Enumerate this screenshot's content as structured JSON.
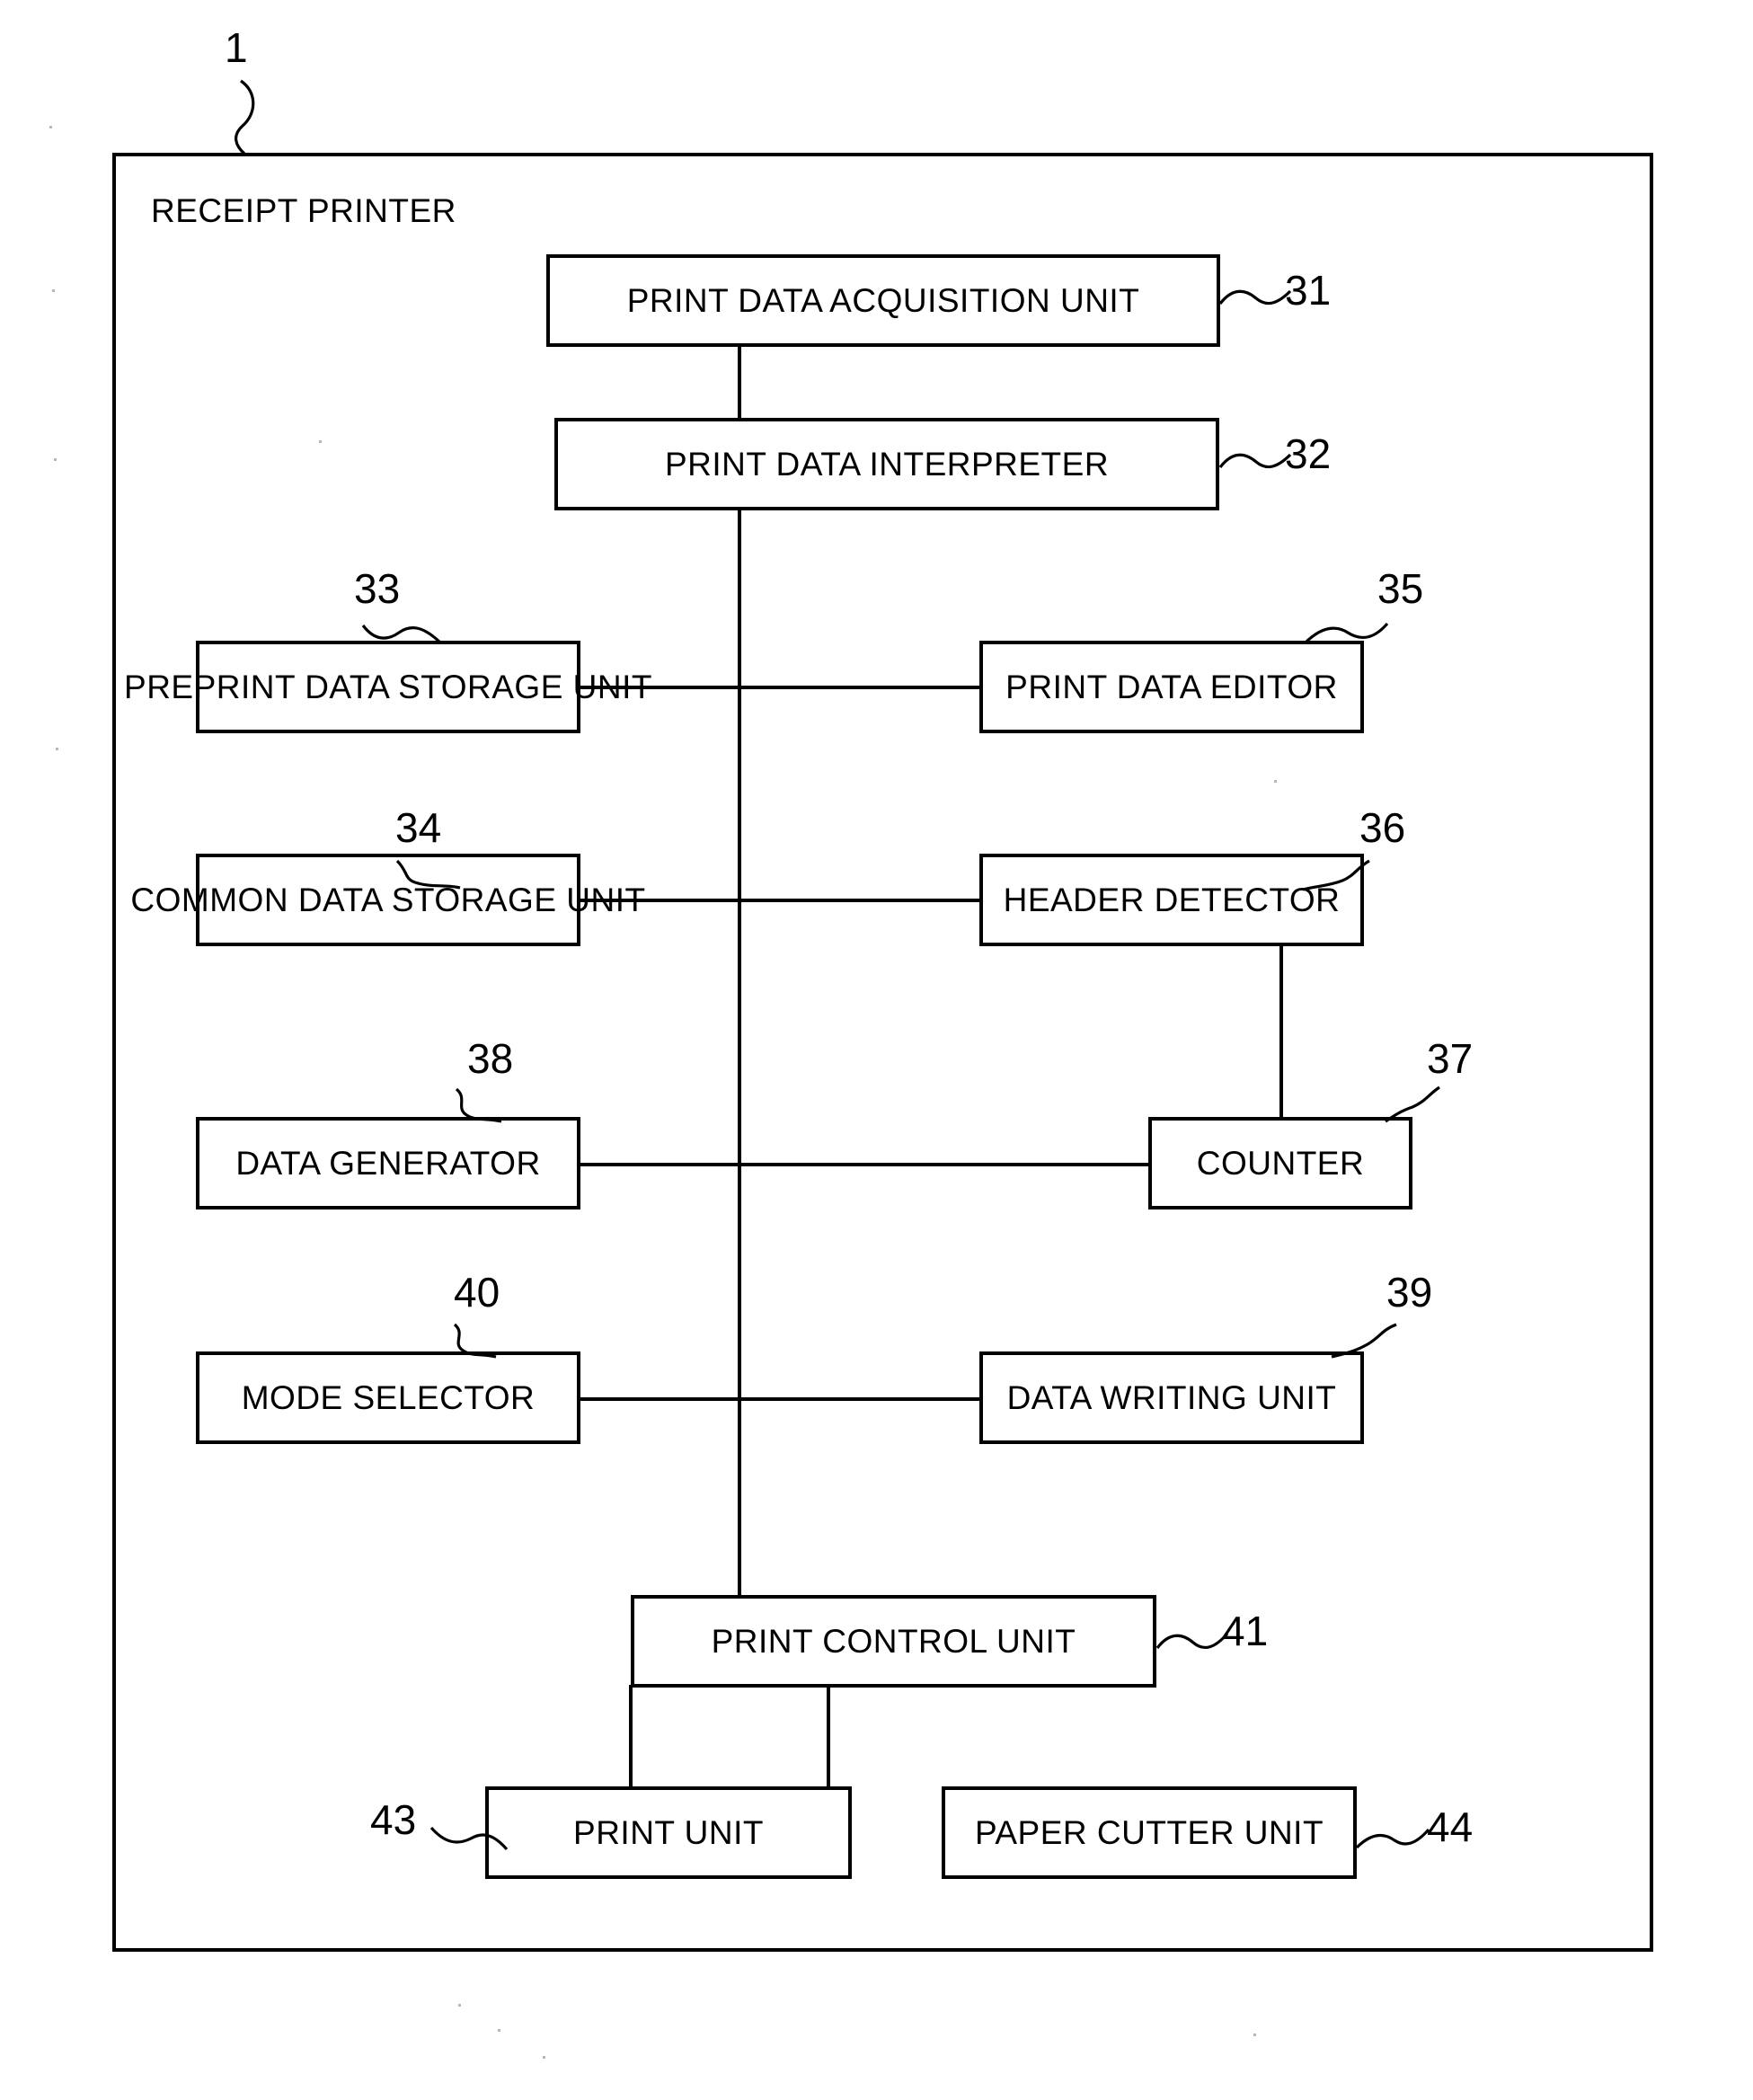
{
  "figure": {
    "enclosure_title": "RECEIPT PRINTER",
    "enclosure_ref": "1",
    "background_color": "#ffffff",
    "line_color": "#000000"
  },
  "blocks": [
    {
      "id": "print-data-acquisition-unit",
      "label": "PRINT DATA ACQUISITION UNIT",
      "ref": "31"
    },
    {
      "id": "print-data-interpreter",
      "label": "PRINT DATA INTERPRETER",
      "ref": "32"
    },
    {
      "id": "preprint-data-storage-unit",
      "label": "PREPRINT DATA STORAGE UNIT",
      "ref": "33"
    },
    {
      "id": "common-data-storage-unit",
      "label": "COMMON DATA STORAGE UNIT",
      "ref": "34"
    },
    {
      "id": "print-data-editor",
      "label": "PRINT DATA EDITOR",
      "ref": "35"
    },
    {
      "id": "header-detector",
      "label": "HEADER DETECTOR",
      "ref": "36"
    },
    {
      "id": "counter",
      "label": "COUNTER",
      "ref": "37"
    },
    {
      "id": "data-generator",
      "label": "DATA GENERATOR",
      "ref": "38"
    },
    {
      "id": "data-writing-unit",
      "label": "DATA WRITING UNIT",
      "ref": "39"
    },
    {
      "id": "mode-selector",
      "label": "MODE SELECTOR",
      "ref": "40"
    },
    {
      "id": "print-control-unit",
      "label": "PRINT CONTROL UNIT",
      "ref": "41"
    },
    {
      "id": "print-unit",
      "label": "PRINT UNIT",
      "ref": "43"
    },
    {
      "id": "paper-cutter-unit",
      "label": "PAPER CUTTER UNIT",
      "ref": "44"
    }
  ]
}
